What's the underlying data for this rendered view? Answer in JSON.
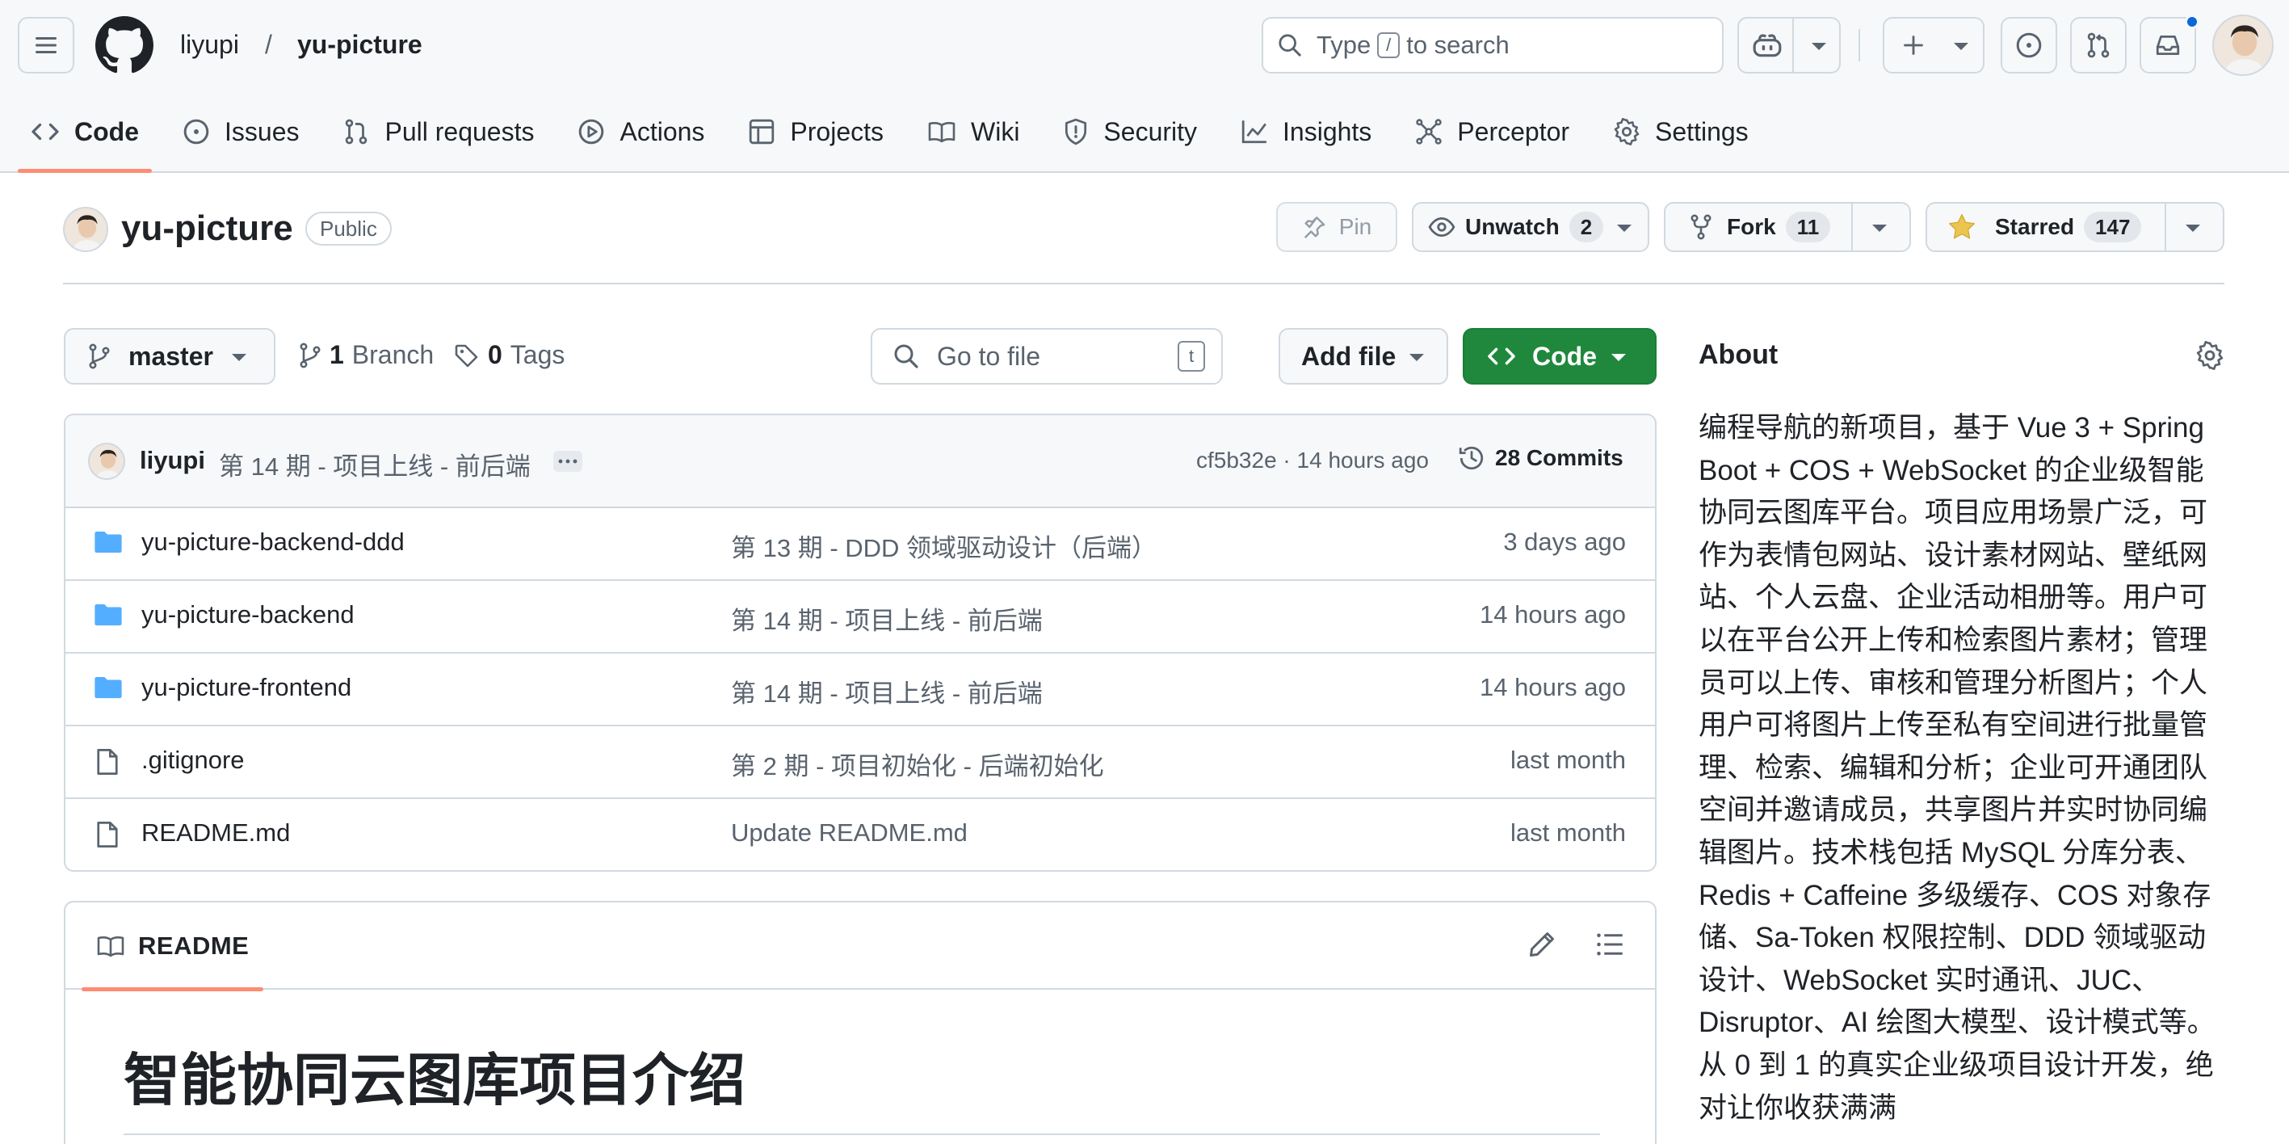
{
  "header": {
    "owner": "liyupi",
    "separator": "/",
    "repo": "yu-picture",
    "search": {
      "prefix": "Type",
      "key": "/",
      "suffix": "to search"
    }
  },
  "tabs": [
    {
      "label": "Code",
      "icon": "code-icon",
      "active": true
    },
    {
      "label": "Issues",
      "icon": "issue-icon"
    },
    {
      "label": "Pull requests",
      "icon": "pull-request-icon"
    },
    {
      "label": "Actions",
      "icon": "play-icon"
    },
    {
      "label": "Projects",
      "icon": "table-icon"
    },
    {
      "label": "Wiki",
      "icon": "book-icon"
    },
    {
      "label": "Security",
      "icon": "shield-icon"
    },
    {
      "label": "Insights",
      "icon": "graph-icon"
    },
    {
      "label": "Perceptor",
      "icon": "nodes-icon"
    },
    {
      "label": "Settings",
      "icon": "gear-icon"
    }
  ],
  "repo_header": {
    "name": "yu-picture",
    "visibility": "Public",
    "pin_label": "Pin",
    "unwatch_label": "Unwatch",
    "watch_count": "2",
    "fork_label": "Fork",
    "fork_count": "11",
    "star_label": "Starred",
    "star_count": "147"
  },
  "file_nav": {
    "branch": "master",
    "branch_count": "1",
    "branch_label": "Branch",
    "tag_count": "0",
    "tag_label": "Tags",
    "go_to_file_placeholder": "Go to file",
    "go_to_file_key": "t",
    "add_file_label": "Add file",
    "code_label": "Code"
  },
  "latest_commit": {
    "author": "liyupi",
    "message": "第 14 期 - 项目上线 - 前后端",
    "hash_time": "cf5b32e · 14 hours ago",
    "commits_label": "28 Commits"
  },
  "files": [
    {
      "type": "dir",
      "name": "yu-picture-backend-ddd",
      "message": "第 13 期 - DDD 领域驱动设计（后端）",
      "date": "3 days ago"
    },
    {
      "type": "dir",
      "name": "yu-picture-backend",
      "message": "第 14 期 - 项目上线 - 前后端",
      "date": "14 hours ago"
    },
    {
      "type": "dir",
      "name": "yu-picture-frontend",
      "message": "第 14 期 - 项目上线 - 前后端",
      "date": "14 hours ago"
    },
    {
      "type": "file",
      "name": ".gitignore",
      "message": "第 2 期 - 项目初始化 - 后端初始化",
      "date": "last month"
    },
    {
      "type": "file",
      "name": "README.md",
      "message": "Update README.md",
      "date": "last month"
    }
  ],
  "readme": {
    "tab_label": "README",
    "title": "智能协同云图库项目介绍"
  },
  "about": {
    "title": "About",
    "description": "编程导航的新项目，基于 Vue 3 + Spring Boot + COS + WebSocket 的企业级智能协同云图库平台。项目应用场景广泛，可作为表情包网站、设计素材网站、壁纸网站、个人云盘、企业活动相册等。用户可以在平台公开上传和检索图片素材；管理员可以上传、审核和管理分析图片；个人用户可将图片上传至私有空间进行批量管理、检索、编辑和分析；企业可开通团队空间并邀请成员，共享图片并实时协同编辑图片。技术栈包括 MySQL 分库分表、Redis + Caffeine 多级缓存、COS 对象存储、Sa-Token 权限控制、DDD 领域驱动设计、WebSocket 实时通讯、JUC、Disruptor、AI 绘图大模型、设计模式等。从 0 到 1 的真实企业级项目设计开发，绝对让你收获满满"
  },
  "colors": {
    "accent_green": "#1f883d",
    "tab_underline": "#fd8c73",
    "folder_blue": "#54aeff",
    "star_yellow": "#eac54f",
    "notification_blue": "#0969da"
  }
}
